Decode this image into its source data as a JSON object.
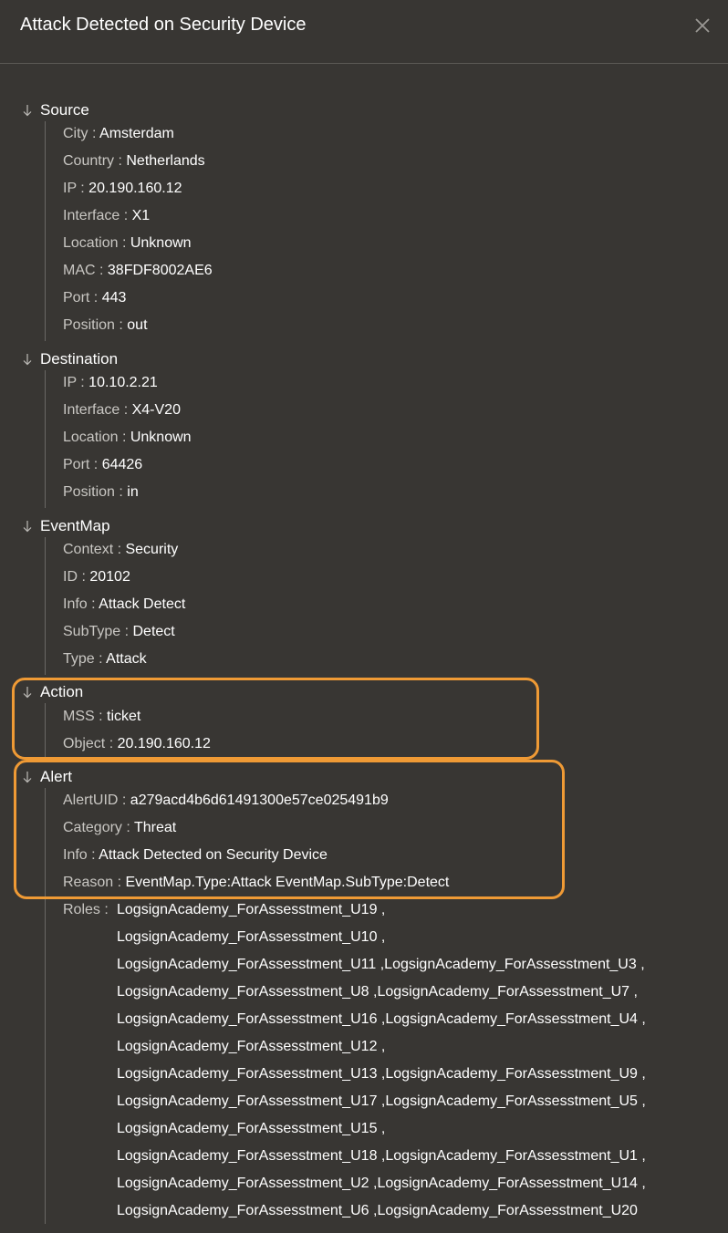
{
  "header": {
    "title": "Attack Detected on Security Device",
    "close_icon": "close-icon"
  },
  "highlight_color": "#ef9a35",
  "sections": {
    "source": {
      "label": "Source",
      "rows": [
        {
          "key": "City",
          "value": "Amsterdam"
        },
        {
          "key": "Country",
          "value": "Netherlands"
        },
        {
          "key": "IP",
          "value": "20.190.160.12"
        },
        {
          "key": "Interface",
          "value": "X1"
        },
        {
          "key": "Location",
          "value": "Unknown"
        },
        {
          "key": "MAC",
          "value": "38FDF8002AE6"
        },
        {
          "key": "Port",
          "value": "443"
        },
        {
          "key": "Position",
          "value": "out"
        }
      ]
    },
    "destination": {
      "label": "Destination",
      "rows": [
        {
          "key": "IP",
          "value": "10.10.2.21"
        },
        {
          "key": "Interface",
          "value": "X4-V20"
        },
        {
          "key": "Location",
          "value": "Unknown"
        },
        {
          "key": "Port",
          "value": "64426"
        },
        {
          "key": "Position",
          "value": "in"
        }
      ]
    },
    "eventmap": {
      "label": "EventMap",
      "rows": [
        {
          "key": "Context",
          "value": "Security"
        },
        {
          "key": "ID",
          "value": "20102"
        },
        {
          "key": "Info",
          "value": "Attack Detect"
        },
        {
          "key": "SubType",
          "value": "Detect"
        },
        {
          "key": "Type",
          "value": "Attack"
        }
      ]
    },
    "action": {
      "label": "Action",
      "rows": [
        {
          "key": "MSS",
          "value": "ticket"
        },
        {
          "key": "Object",
          "value": "20.190.160.12"
        }
      ]
    },
    "alert": {
      "label": "Alert",
      "rows": [
        {
          "key": "AlertUID",
          "value": "a279acd4b6d61491300e57ce025491b9"
        },
        {
          "key": "Category",
          "value": "Threat"
        },
        {
          "key": "Info",
          "value": "Attack Detected on Security Device"
        },
        {
          "key": "Reason",
          "value": "EventMap.Type:Attack EventMap.SubType:Detect"
        }
      ],
      "roles_key": "Roles",
      "roles_lines": [
        "LogsignAcademy_ForAssesstment_U19 ,",
        "LogsignAcademy_ForAssesstment_U10 ,",
        "LogsignAcademy_ForAssesstment_U11 ,LogsignAcademy_ForAssesstment_U3 ,",
        "LogsignAcademy_ForAssesstment_U8 ,LogsignAcademy_ForAssesstment_U7 ,",
        "LogsignAcademy_ForAssesstment_U16 ,LogsignAcademy_ForAssesstment_U4 ,",
        "LogsignAcademy_ForAssesstment_U12 ,",
        "LogsignAcademy_ForAssesstment_U13 ,LogsignAcademy_ForAssesstment_U9 ,",
        "LogsignAcademy_ForAssesstment_U17 ,LogsignAcademy_ForAssesstment_U5 ,",
        "LogsignAcademy_ForAssesstment_U15 ,",
        "LogsignAcademy_ForAssesstment_U18 ,LogsignAcademy_ForAssesstment_U1 ,",
        "LogsignAcademy_ForAssesstment_U2 ,LogsignAcademy_ForAssesstment_U14 ,",
        "LogsignAcademy_ForAssesstment_U6 ,LogsignAcademy_ForAssesstment_U20"
      ]
    }
  }
}
